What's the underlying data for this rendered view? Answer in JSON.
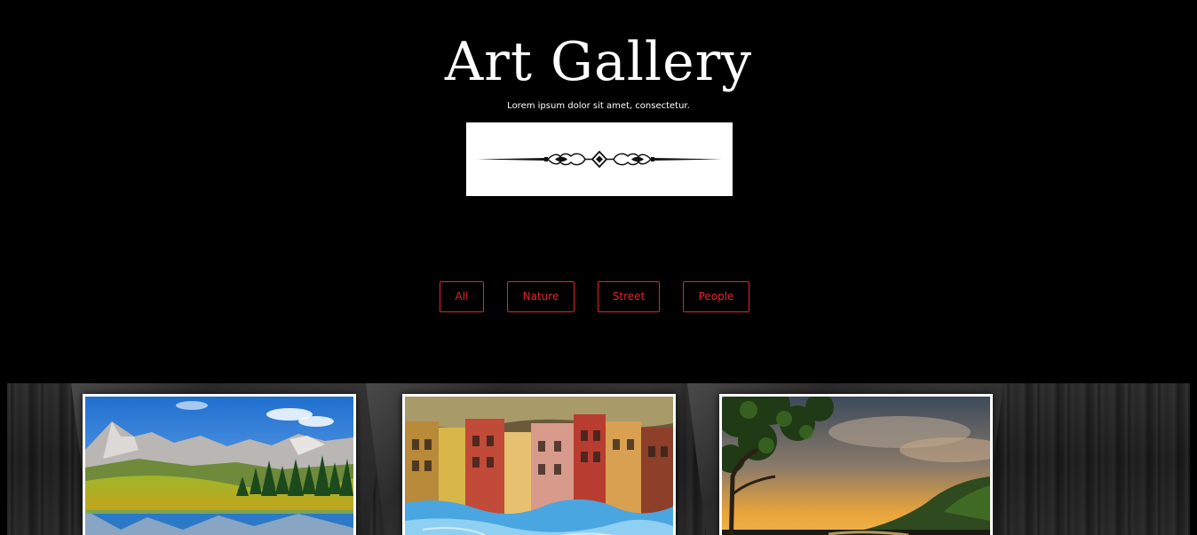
{
  "header": {
    "title": "Art Gallery",
    "tagline": "Lorem ipsum dolor sit amet, consectetur."
  },
  "divider": {
    "icon": "ornamental-divider-icon"
  },
  "filters": [
    {
      "label": "All"
    },
    {
      "label": "Nature"
    },
    {
      "label": "Street"
    },
    {
      "label": "People"
    }
  ],
  "gallery": {
    "items": [
      {
        "subject": "mountain lake landscape",
        "category": "Nature"
      },
      {
        "subject": "reflection of colorful buildings in water",
        "category": "Street"
      },
      {
        "subject": "sunset through trees",
        "category": "Nature"
      }
    ]
  },
  "colors": {
    "background": "#000000",
    "accent": "#e0252d",
    "text": "#ffffff"
  }
}
